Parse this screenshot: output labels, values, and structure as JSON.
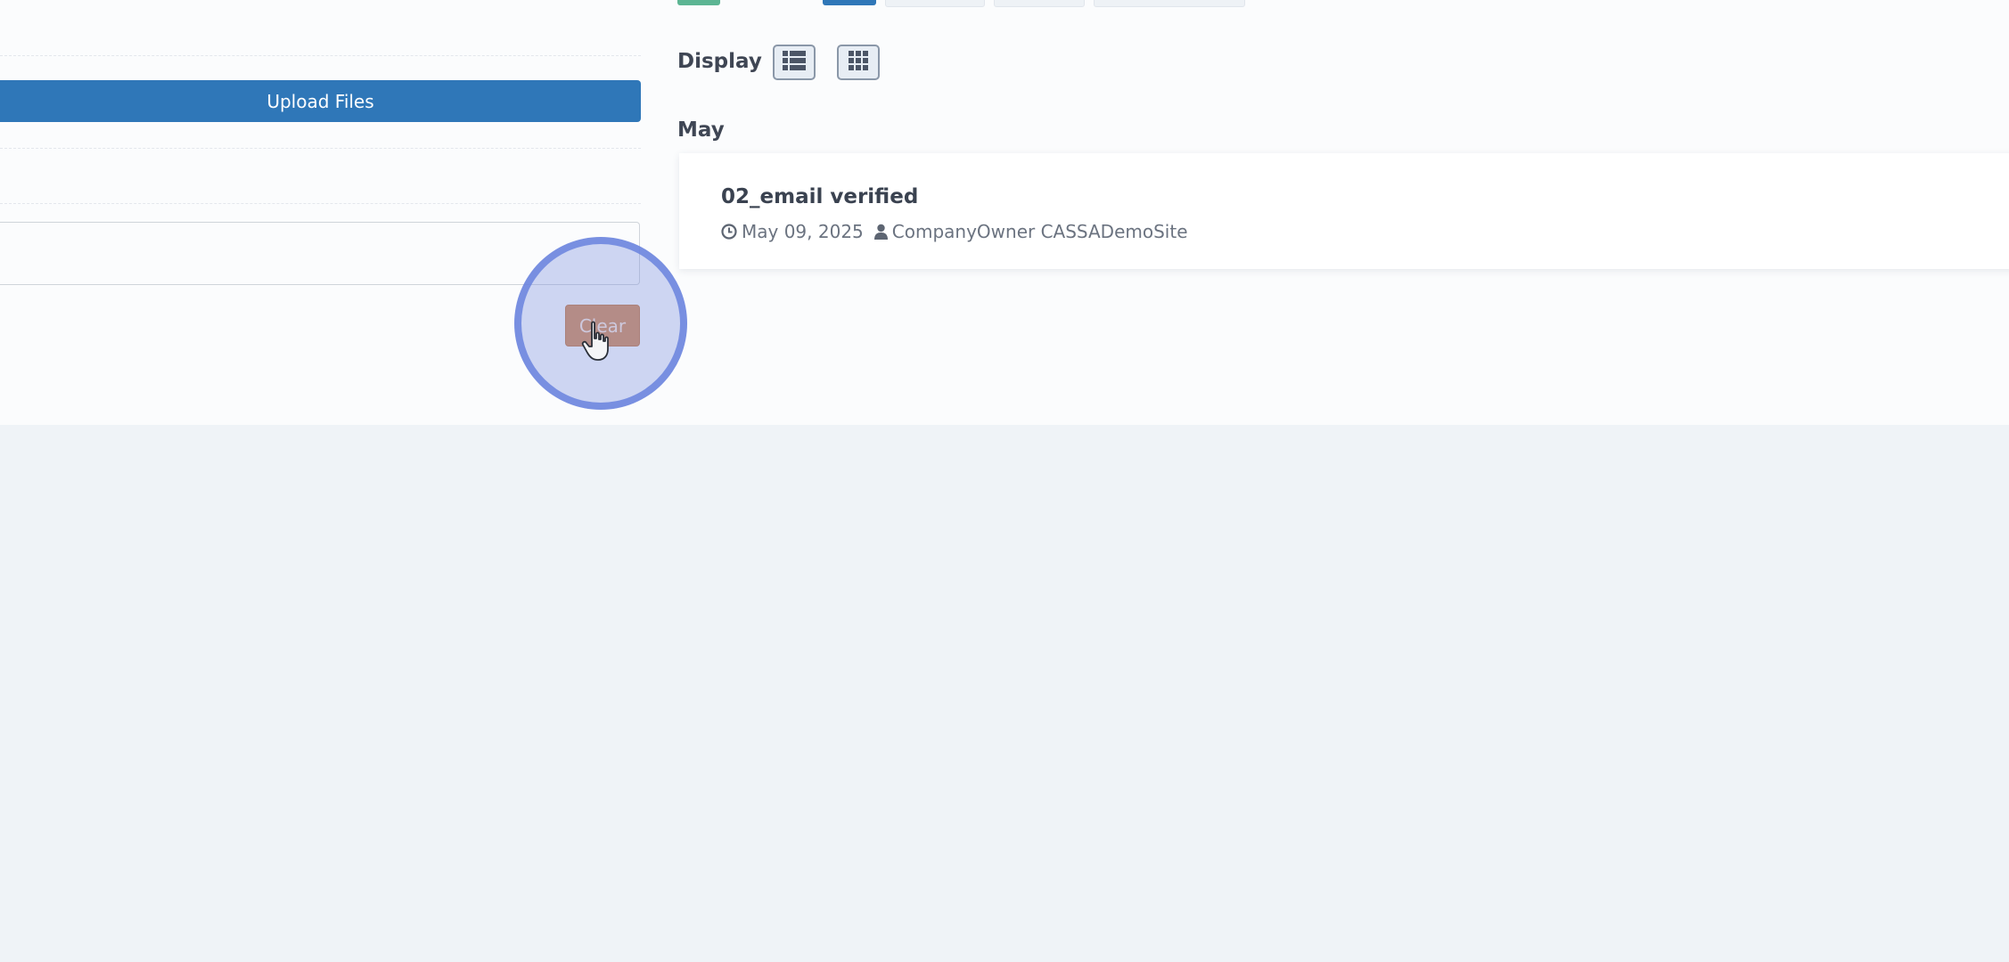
{
  "colors": {
    "page_bg": "#eff3f7",
    "panel_bg": "#fbfcfd",
    "primary": "#2f77b8",
    "clear": "#d48c5a",
    "tab_green": "#5cb593",
    "click_highlight": "#6982de"
  },
  "left": {
    "upload_button_label": "Upload Files",
    "clear_button_label": "Clear"
  },
  "right": {
    "display_label": "Display",
    "view_options": [
      {
        "icon": "list-view-icon"
      },
      {
        "icon": "grid-view-icon"
      }
    ],
    "groups": [
      {
        "month": "May",
        "items": [
          {
            "title": "02_email verified",
            "date": "May 09, 2025",
            "author": "CompanyOwner CASSADemoSite",
            "date_icon": "clock-icon",
            "author_icon": "user-icon"
          }
        ]
      }
    ]
  }
}
